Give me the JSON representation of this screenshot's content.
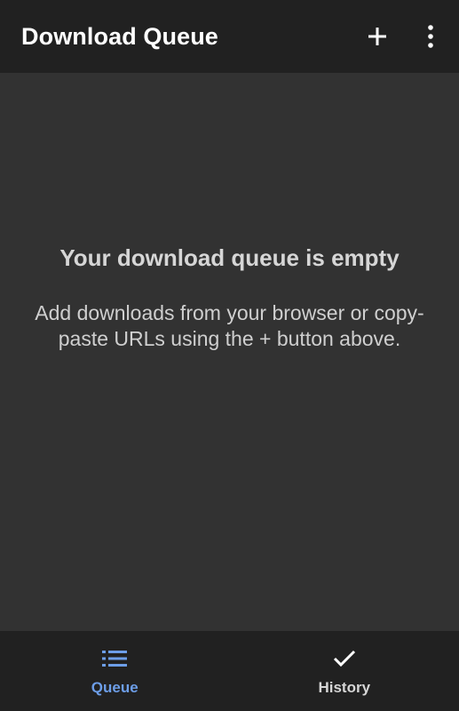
{
  "appbar": {
    "title": "Download Queue",
    "actions": [
      {
        "name": "add",
        "icon": "plus-icon"
      },
      {
        "name": "more",
        "icon": "more-vert-icon"
      }
    ]
  },
  "empty_state": {
    "title": "Your download queue is empty",
    "message": "Add downloads from your browser or copy-paste URLs using the + button above."
  },
  "bottom_nav": {
    "items": [
      {
        "label": "Queue",
        "icon": "list-icon",
        "active": true
      },
      {
        "label": "History",
        "icon": "check-icon",
        "active": false
      }
    ]
  },
  "colors": {
    "appbar_bg": "#212121",
    "content_bg": "#323232",
    "accent": "#6d9ee8",
    "text_primary": "#ffffff",
    "text_secondary": "#cfcfcf"
  }
}
